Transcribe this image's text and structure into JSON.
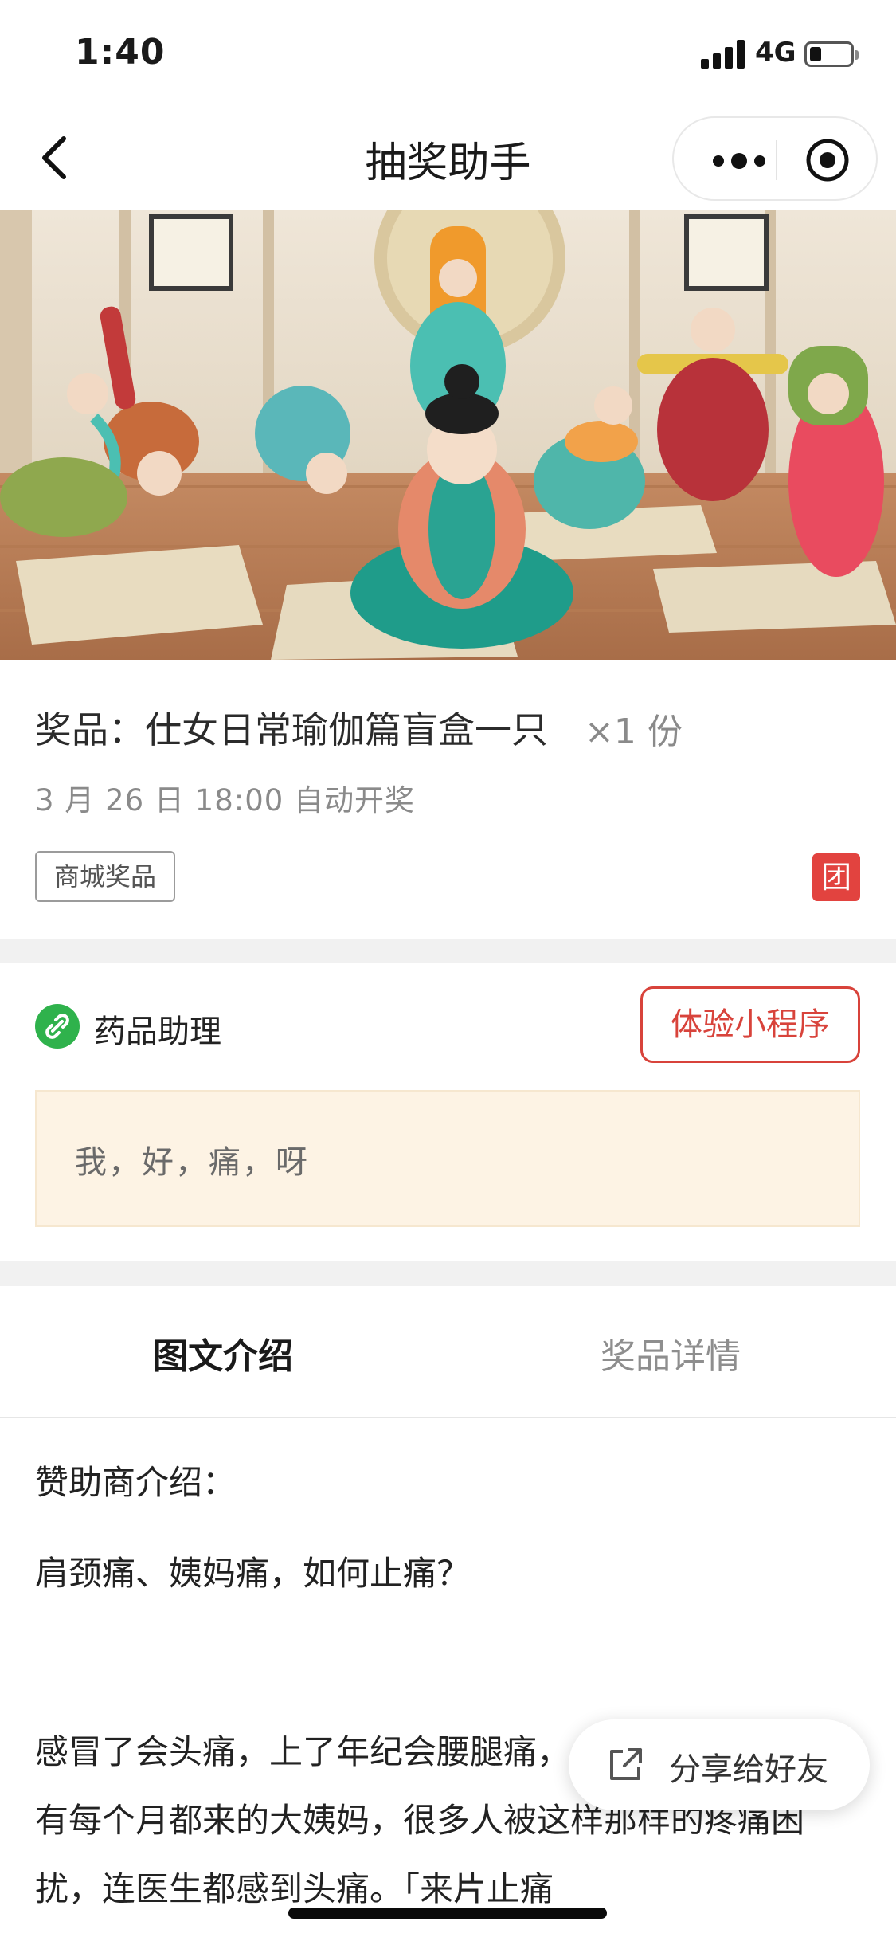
{
  "status_bar": {
    "time": "1:40",
    "network": "4G"
  },
  "nav": {
    "title": "抽奖助手"
  },
  "prize": {
    "title": "奖品：仕女日常瑜伽篇盲盒一只",
    "quantity": "×1 份",
    "draw_time": "3 月 26 日 18:00 自动开奖",
    "tag": "商城奖品",
    "group_badge": "团"
  },
  "sponsor": {
    "name": "药品助理",
    "try_button": "体验小程序",
    "note": "我，好，痛，呀"
  },
  "tabs": [
    {
      "label": "图文介绍",
      "active": true
    },
    {
      "label": "奖品详情",
      "active": false
    }
  ],
  "article": {
    "paragraphs": [
      "赞助商介绍：",
      "肩颈痛、姨妈痛，如何止痛？",
      "感冒了会头痛，上了年纪会腰腿痛，久坐会肩颈痛，还有每个月都来的大姨妈，很多人被这样那样的疼痛困扰，连医生都感到头痛。「来片止痛"
    ]
  },
  "share": {
    "label": "分享给好友"
  },
  "colors": {
    "accent_red": "#d8433b",
    "mp_green": "#2fb24c",
    "note_bg": "#fdf3e4"
  }
}
